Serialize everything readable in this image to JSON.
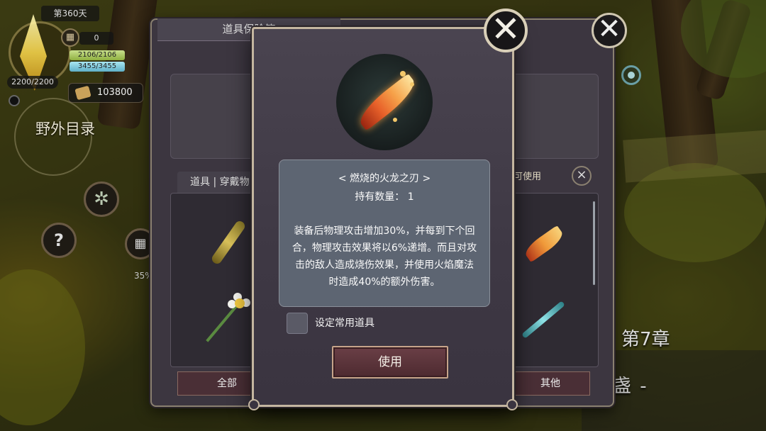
{
  "hud": {
    "day": "第360天",
    "calendar_count": "0",
    "hp_bar": "2106/2106",
    "mp_bar": "3455/3455",
    "crystal_value": "2200/2200",
    "gold": "103800",
    "field_label": "野外目录",
    "help_glyph": "?",
    "progress_pct": "35%"
  },
  "scene": {
    "chapter": "第7章",
    "chapter_subtitle": "一盏 -"
  },
  "storage": {
    "title": "道具保险箱",
    "tab_label": "道具 | 穿戴物",
    "hint": "具即可使用",
    "filters": [
      "全部",
      "其他"
    ]
  },
  "dialog": {
    "item_name": "< 燃烧的火龙之刃 >",
    "count_label": "持有数量：",
    "count_value": "1",
    "description": "装备后物理攻击增加30%，并每到下个回合，物理攻击效果将以6%递增。而且对攻击的敌人造成烧伤效果，并使用火焰魔法时造成40%的额外伤害。",
    "favorite_label": "设定常用道具",
    "use_button": "使用"
  },
  "icons": {
    "close": "close-icon",
    "gear": "gear-icon",
    "calendar": "calendar-icon",
    "gold": "gold-icon",
    "help": "help-icon",
    "pin": "map-pin-icon"
  }
}
